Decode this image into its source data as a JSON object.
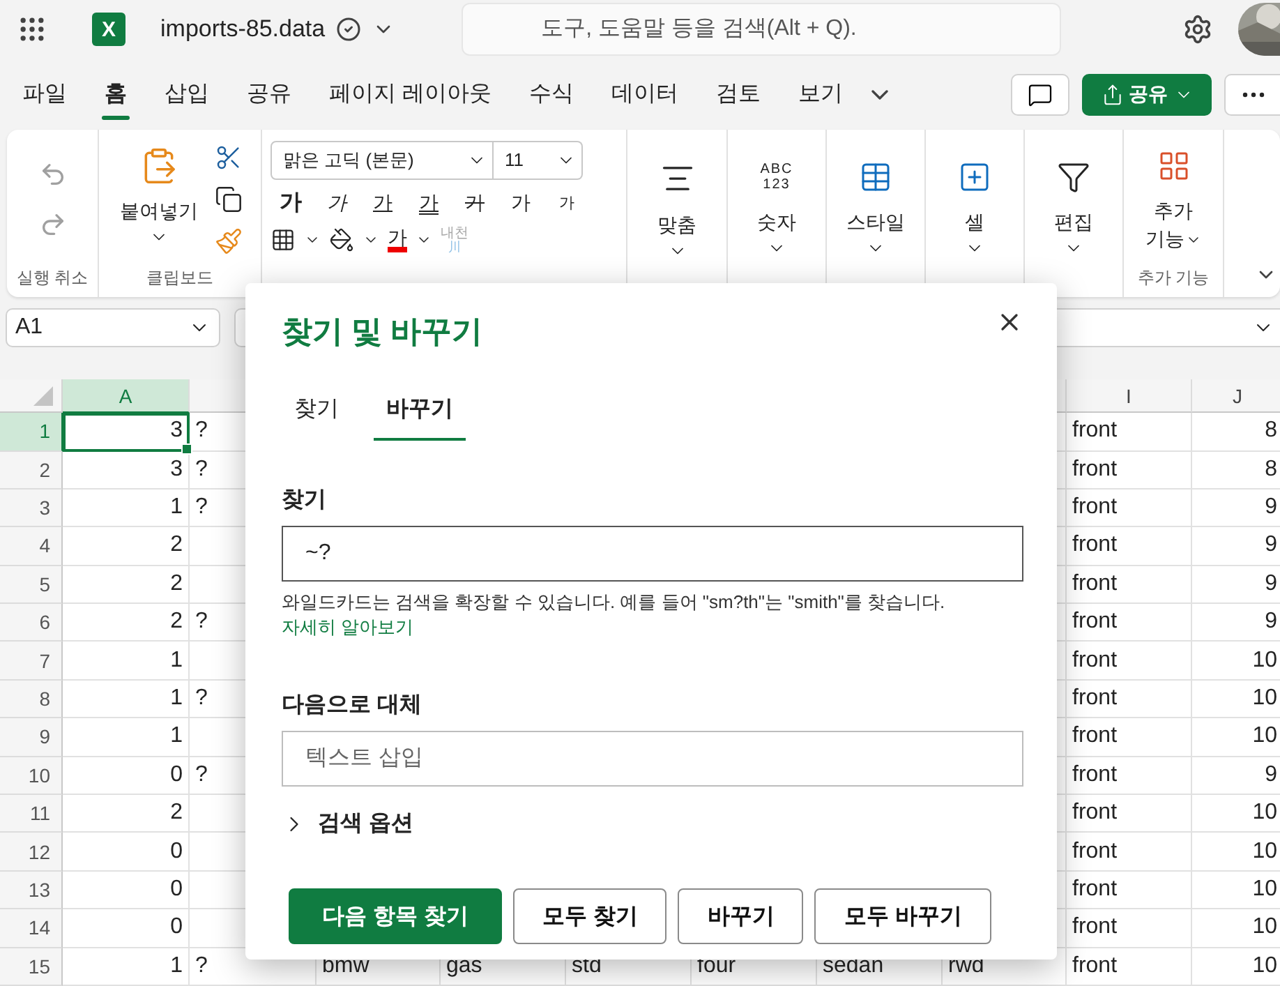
{
  "app_bar": {
    "logo_letter": "X",
    "file_name": "imports-85.data",
    "search": {
      "placeholder": "도구, 도움말 등을 검색(Alt + Q)."
    }
  },
  "menu_tabs": [
    {
      "label": "파일",
      "selected": false
    },
    {
      "label": "홈",
      "selected": true
    },
    {
      "label": "삽입",
      "selected": false
    },
    {
      "label": "공유",
      "selected": false
    },
    {
      "label": "페이지 레이아웃",
      "selected": false
    },
    {
      "label": "수식",
      "selected": false
    },
    {
      "label": "데이터",
      "selected": false
    },
    {
      "label": "검토",
      "selected": false
    },
    {
      "label": "보기",
      "selected": false
    }
  ],
  "share_button": {
    "label": "공유"
  },
  "ribbon": {
    "undo": {
      "label": "실행 취소",
      "undo_disabled": true,
      "redo_disabled": true
    },
    "clipboard": {
      "paste_label": "붙여넣기",
      "label": "클립보드"
    },
    "font": {
      "font_name": "맑은 고딕 (본문)",
      "font_size": "11",
      "style_buttons": [
        {
          "label": "가",
          "kind": "bold"
        },
        {
          "label": "가",
          "kind": "italic"
        },
        {
          "label": "가",
          "kind": "underline"
        },
        {
          "label": "가",
          "kind": "double-underline"
        },
        {
          "label": "가",
          "kind": "strike"
        },
        {
          "label": "가",
          "kind": "grow"
        },
        {
          "label": "가",
          "kind": "shrink"
        }
      ],
      "font_color_label": "가",
      "phonetic": {
        "label": "내천",
        "sub": "川",
        "disabled": true
      }
    },
    "commands": [
      {
        "label": "맞춤",
        "kind": "align"
      },
      {
        "label": "숫자",
        "kind": "number",
        "icon_text": [
          "ABC",
          "123"
        ]
      },
      {
        "label": "스타일",
        "kind": "style"
      },
      {
        "label": "셀",
        "kind": "cells"
      },
      {
        "label": "편집",
        "kind": "editing"
      }
    ],
    "addins": {
      "label_lines": [
        "추가",
        "기능"
      ],
      "group_label": "추가 기능"
    }
  },
  "formula_bar": {
    "name_box": "A1"
  },
  "sheet": {
    "columns": [
      {
        "label": "A",
        "selected": true
      },
      {},
      {},
      {},
      {},
      {},
      {},
      {},
      {
        "label": "I",
        "selected": false
      },
      {
        "label": "J",
        "selected": false
      }
    ],
    "rows": [
      {
        "number": "1",
        "selected": true,
        "cells": [
          "3",
          "?",
          null,
          null,
          null,
          null,
          null,
          null,
          "front",
          "8"
        ]
      },
      {
        "number": "2",
        "selected": false,
        "cells": [
          "3",
          "?",
          null,
          null,
          null,
          null,
          null,
          null,
          "front",
          "8"
        ]
      },
      {
        "number": "3",
        "selected": false,
        "cells": [
          "1",
          "?",
          null,
          null,
          null,
          null,
          null,
          null,
          "front",
          "9"
        ]
      },
      {
        "number": "4",
        "selected": false,
        "cells": [
          "2",
          null,
          null,
          null,
          null,
          null,
          null,
          null,
          "front",
          "9"
        ]
      },
      {
        "number": "5",
        "selected": false,
        "cells": [
          "2",
          null,
          null,
          null,
          null,
          null,
          null,
          null,
          "front",
          "9"
        ]
      },
      {
        "number": "6",
        "selected": false,
        "cells": [
          "2",
          "?",
          null,
          null,
          null,
          null,
          null,
          null,
          "front",
          "9"
        ]
      },
      {
        "number": "7",
        "selected": false,
        "cells": [
          "1",
          null,
          null,
          null,
          null,
          null,
          null,
          null,
          "front",
          "10"
        ]
      },
      {
        "number": "8",
        "selected": false,
        "cells": [
          "1",
          "?",
          null,
          null,
          null,
          null,
          null,
          null,
          "front",
          "10"
        ]
      },
      {
        "number": "9",
        "selected": false,
        "cells": [
          "1",
          null,
          null,
          null,
          null,
          null,
          null,
          null,
          "front",
          "10"
        ]
      },
      {
        "number": "10",
        "selected": false,
        "cells": [
          "0",
          "?",
          null,
          null,
          null,
          null,
          null,
          null,
          "front",
          "9"
        ]
      },
      {
        "number": "11",
        "selected": false,
        "cells": [
          "2",
          null,
          null,
          null,
          null,
          null,
          null,
          null,
          "front",
          "10"
        ]
      },
      {
        "number": "12",
        "selected": false,
        "cells": [
          "0",
          null,
          null,
          null,
          null,
          null,
          null,
          null,
          "front",
          "10"
        ]
      },
      {
        "number": "13",
        "selected": false,
        "cells": [
          "0",
          null,
          null,
          null,
          null,
          null,
          null,
          null,
          "front",
          "10"
        ]
      },
      {
        "number": "14",
        "selected": false,
        "cells": [
          "0",
          null,
          null,
          null,
          null,
          null,
          null,
          null,
          "front",
          "10"
        ]
      },
      {
        "number": "15",
        "selected": false,
        "cells": [
          "1",
          "?",
          "bmw",
          "gas",
          "std",
          "four",
          "sedan",
          "rwd",
          "front",
          "10"
        ]
      }
    ]
  },
  "dialog": {
    "title": "찾기 및 바꾸기",
    "tabs": [
      {
        "label": "찾기",
        "selected": false
      },
      {
        "label": "바꾸기",
        "selected": true
      }
    ],
    "find": {
      "label": "찾기",
      "value": "~?"
    },
    "hint": "와일드카드는 검색을 확장할 수 있습니다. 예를 들어 \"sm?th\"는 \"smith\"를 찾습니다.",
    "hint_link": "자세히 알아보기",
    "replace": {
      "label": "다음으로 대체",
      "placeholder": "텍스트 삽입"
    },
    "options": {
      "label": "검색 옵션",
      "expanded": false
    },
    "buttons": [
      {
        "label": "다음 항목 찾기",
        "kind": "primary"
      },
      {
        "label": "모두 찾기",
        "kind": "secondary"
      },
      {
        "label": "바꾸기",
        "kind": "secondary"
      },
      {
        "label": "모두 바꾸기",
        "kind": "secondary"
      }
    ]
  }
}
